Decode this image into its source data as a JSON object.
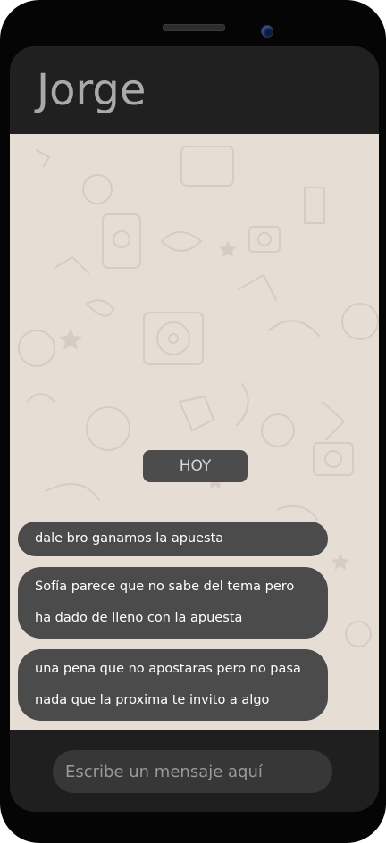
{
  "header": {
    "contact_name": "Jorge"
  },
  "chat": {
    "day_divider": "HOY",
    "messages": [
      {
        "lines": [
          "dale bro ganamos la apuesta"
        ]
      },
      {
        "lines": [
          "Sofía parece que no sabe del tema pero",
          "ha dado de lleno con la apuesta"
        ]
      },
      {
        "lines": [
          "una pena que no apostaras pero no pasa",
          "nada que la proxima te invito a algo"
        ]
      }
    ]
  },
  "composer": {
    "placeholder": "Escribe un mensaje aquí"
  },
  "colors": {
    "phone_frame": "#050505",
    "header_bg": "#202020",
    "chat_bg": "#e6ddd5",
    "bubble_bg": "#4b4b4b",
    "input_bg": "#373737"
  },
  "icons": [
    "speaker-grille",
    "front-camera"
  ]
}
